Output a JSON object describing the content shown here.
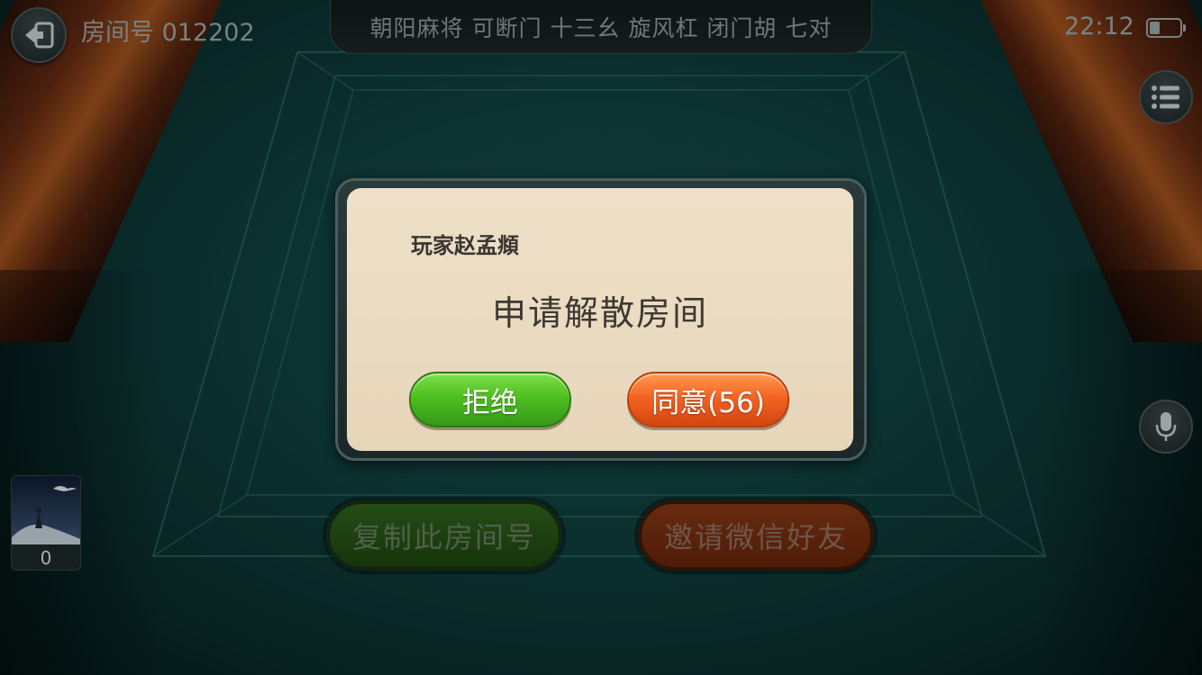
{
  "top_bar": {
    "room_label": "房间号 012202",
    "rules": "朝阳麻将  可断门  十三幺  旋风杠  闭门胡  七对",
    "clock": "22:12",
    "battery_level": 0.35
  },
  "player": {
    "score": "0"
  },
  "table_buttons": {
    "copy_room": "复制此房间号",
    "invite_wechat": "邀请微信好友"
  },
  "dialog": {
    "player_name": "玩家赵孟頫",
    "message": "申请解散房间",
    "reject_label": "拒绝",
    "agree_label": "同意(56)"
  },
  "icons": {
    "back": "back-arrow-icon",
    "menu": "menu-list-icon",
    "mic": "microphone-icon"
  }
}
